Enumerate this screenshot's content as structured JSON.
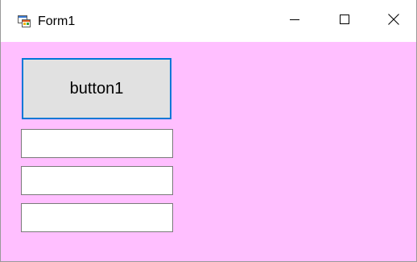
{
  "window": {
    "title": "Form1",
    "app_icon": "winforms-app-icon",
    "controls": {
      "minimize_icon": "minimize-icon",
      "maximize_icon": "maximize-icon",
      "close_icon": "close-icon"
    }
  },
  "form": {
    "background_color": "#ffbfff",
    "button1": {
      "label": "button1",
      "focus_border_color": "#0078d7"
    },
    "textboxes": [
      {
        "value": "",
        "placeholder": ""
      },
      {
        "value": "",
        "placeholder": ""
      },
      {
        "value": "",
        "placeholder": ""
      }
    ]
  }
}
